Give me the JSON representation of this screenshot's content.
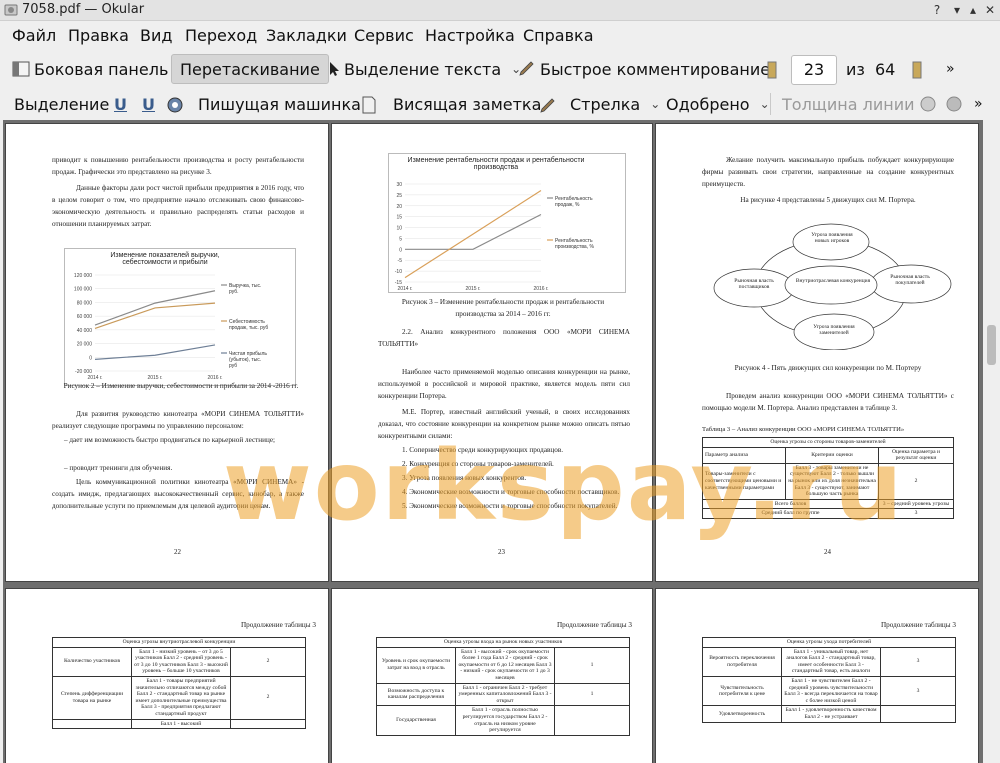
{
  "window": {
    "title": "7058.pdf  — Okular"
  },
  "menu": [
    "Файл",
    "Правка",
    "Вид",
    "Переход",
    "Закладки",
    "Сервис",
    "Настройка",
    "Справка"
  ],
  "toolbar1": {
    "sidebar": "Боковая панель",
    "drag": "Перетаскивание",
    "select_text": "Выделение текста",
    "quick_comment": "Быстрое комментирование",
    "page_current": "23",
    "page_of": "из",
    "page_total": "64"
  },
  "toolbar2": {
    "selection": "Выделение",
    "typewriter": "Пишущая машинка",
    "sticky": "Висящая заметка",
    "arrow": "Стрелка",
    "approved": "Одобрено",
    "line_width": "Толщина линии"
  },
  "watermark": "workspay.ru",
  "p22": {
    "t1": "приводит к повышению рентабельности производства и росту рентабельности продаж. Графически это представлено на рисунке 3.",
    "t2": "Данные факторы дали рост чистой прибыли предприятия в 2016 году, что в целом говорит о том, что предприятие начало отслеживать свою финансово-экономическую деятельность и правильно распределять статьи расходов и отношении планируемых затрат.",
    "caption": "Рисунок 2 – Изменение выручки, себестоимости и прибыли за 2014 -2016 гг.",
    "t3": "Для развития руководство кинотеатра «МОРИ СИНЕМА ТОЛЬЯТТИ» реализует следующие программы по управлению персоналом:",
    "t4": "–      дает им возможность быстро продвигаться по карьерной лестнице;",
    "t5": "–      проводит тренинги для обучения.",
    "t6": "Цель коммуникационной политики кинотеатра «МОРИ СИНЕМА» - создать имидж, предлагающих высококачественный сервис, кинобар, а также дополнительные услуги по приемлемым для целевой аудитории ценам.",
    "num": "22"
  },
  "chart1": {
    "type": "line",
    "title": "Изменение показателей выручки, себестоимости и прибыли",
    "categories": [
      "2014 г.",
      "2015 г.",
      "2016 г."
    ],
    "yticks": [
      "120 000",
      "100 000",
      "80 000",
      "60 000",
      "40 000",
      "20 000",
      "0",
      "-20 000"
    ],
    "ylim": [
      -20000,
      120000
    ],
    "series": [
      {
        "name": "Выручка, тыс. руб.",
        "values": [
          47000,
          79000,
          97000
        ],
        "color": "#8a8a8a"
      },
      {
        "name": "Себестоимость продаж, тыс. руб",
        "values": [
          42000,
          72000,
          79000
        ],
        "color": "#c99a5a"
      },
      {
        "name": "Чистая прибыль (убыток), тыс. руб",
        "values": [
          -3000,
          3000,
          18000
        ],
        "color": "#6e7f96"
      }
    ]
  },
  "p23": {
    "caption": "Рисунок 3 – Изменение рентабельности продаж и рентабельности производства за 2014 – 2016 гг.",
    "t1": "2.2. Анализ конкурентного положения ООО «МОРИ СИНЕМА ТОЛЬЯТТИ»",
    "t2": "Наиболее часто применяемой моделью описания конкуренции на рынке, используемой в российской и мировой практике, является модель пяти сил конкуренции Портера.",
    "t3": "М.Е. Портер, известный английский ученый, в своих исследованиях доказал, что состояние конкуренции на конкретном рынке можно описать пятью конкурентными силами:",
    "items": [
      "1. Соперничество среди конкурирующих продавцов.",
      "2. Конкуренция со стороны товаров-заменителей.",
      "3. Угроза появления новых конкурентов.",
      "4. Экономические возможности и торговые способности поставщиков.",
      "5. Экономические возможности и торговые способности покупателей."
    ],
    "num": "23"
  },
  "chart2": {
    "type": "line",
    "title": "Изменение рентабельности продаж и рентабельности производства",
    "categories": [
      "2014 г.",
      "2015 г.",
      "2016 г."
    ],
    "yticks": [
      "30",
      "25",
      "20",
      "15",
      "10",
      "5",
      "0",
      "-5",
      "-10",
      "-15"
    ],
    "ylim": [
      -15,
      30
    ],
    "series": [
      {
        "name": "Рентабельность продаж, %",
        "values": [
          0,
          0,
          16
        ],
        "color": "#8a8a8a"
      },
      {
        "name": "Рентабельность производства, %",
        "values": [
          -13,
          7,
          27
        ],
        "color": "#d9a05a"
      }
    ]
  },
  "p24": {
    "t1": "Желание получить максимальную прибыль побуждает конкурирующие фирмы развивать свои стратегии, направленные на создание конкурентных преимуществ.",
    "t2": "На рисунке 4 представлены 5 движущих сил М. Портера.",
    "d_top": "Угроза появления новых игроков",
    "d_left": "Рыночная власть поставщиков",
    "d_center": "Внутриотраслевая конкуренция",
    "d_right": "Рыночная власть покупателей",
    "d_bottom": "Угроза появления заменителей",
    "caption": "Рисунок 4 - Пять движущих сил конкуренции по М. Портеру",
    "t3": "Проведем анализ конкуренции ООО «МОРИ СИНЕМА ТОЛЬЯТТИ» с помощью модели М. Портера. Анализ представлен в таблице 3.",
    "table_title": "Таблица 3 – Анализ конкуренции ООО «МОРИ СИНЕМА ТОЛЬЯТТИ»",
    "tbl_head": "Оценка угрозы со стороны товаров-заменителей",
    "tbl_cols": [
      "Параметр анализа",
      "Критерии оценки",
      "Оценка параметра и результат оценки"
    ],
    "tbl_r1": [
      "Товары-заменители с соответствующими ценовыми и качественными параметрами",
      "Балл 3 - товары заменители не существуют Балл 2 - только вышли на рынок или их доля незначительна Балл 3 - существуют, занимают большую часть рынка",
      "2"
    ],
    "tbl_total": [
      "Всего баллов",
      "3 – средний уровень угрозы"
    ],
    "tbl_avg": [
      "Средний балл по группе",
      "3"
    ],
    "num": "24"
  },
  "p25": {
    "cont": "Продолжение таблицы 3",
    "head": "Оценка угрозы внутриотраслевой конкуренции",
    "rows": [
      [
        "Количество участников",
        "Балл 1 - низкий уровень – от 3 до 5 участников Балл 2 - средний уровень - от 3 до 10 участников Балл 3 - высокий уровень – больше 10 участников",
        "2"
      ],
      [
        "Степень дифференциации товара на рынке",
        "Балл 1 - товары предприятий значительно отличаются между собой Балл 2 - стандартный товар на рынке имеет дополнительные преимущества Балл 3 - предприятия предлагают стандартный продукт",
        "2"
      ],
      [
        "",
        "Балл 1 - высокий",
        ""
      ]
    ]
  },
  "p26": {
    "cont": "Продолжение таблицы 3",
    "head": "Оценка угрозы входа на рынок новых участников",
    "rows": [
      [
        "Уровень и срок окупаемости затрат на вход в отрасль",
        "Балл 1 - высокий - срок окупаемости более 1 года Балл 2 - средний - срок окупаемости от 6 до 12 месяцев Балл 3 - низкий - срок окупаемости от 1 до 3 месяцев",
        "1"
      ],
      [
        "Возможность доступа к каналам распределения",
        "Балл 1 - ограничен Балл 2 - требует умеренных капиталовложений Балл 3 - открыт",
        "1"
      ],
      [
        "Государственная",
        "Балл 1 - отрасль полностью регулируется государством Балл 2 - отрасль на низком уровне регулируется",
        ""
      ]
    ]
  },
  "p27": {
    "cont": "Продолжение таблицы 3",
    "head": "Оценка угрозы ухода потребителей",
    "rows": [
      [
        "Вероятность переключения потребителя",
        "Балл 1 - уникальный товар, нет аналогов Балл 2 - стандартный товар, имеет особенности Балл 3 - стандартный товар, есть аналоги",
        "3"
      ],
      [
        "Чувствительность потребителя к цене",
        "Балл 1 - не чувствителен Балл 2 - средний уровень чувствительности Балл 3 - всегда переключается на товар с более низкой ценой",
        "3"
      ],
      [
        "Удовлетворенность",
        "Балл 1 - удовлетворенность качеством Балл 2 - не устраивает",
        ""
      ]
    ]
  }
}
